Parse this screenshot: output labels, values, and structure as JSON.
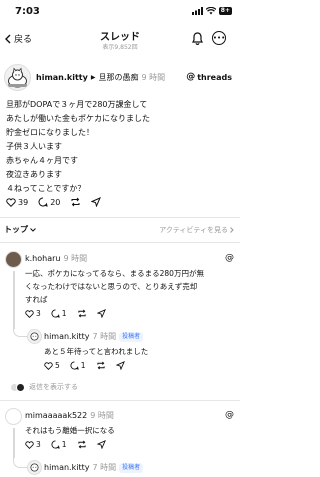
{
  "status_bar": {
    "time": "7:03",
    "battery": "8+"
  },
  "nav": {
    "back_label": "戻る",
    "title": "スレッド",
    "views": "表示9,852回"
  },
  "post": {
    "username": "himan.kitty",
    "arrow": "▶",
    "topic": "旦那の愚痴",
    "time": "9 時間",
    "brand": "threads",
    "lines": [
      "旦那がDOPAで３ヶ月で280万課金して",
      "あたしが働いた金もポケカになりました",
      "貯金ゼロになりました！",
      "子供３人います",
      "赤ちゃん４ヶ月です",
      "夜泣きあります",
      "４ねってことですか？"
    ],
    "likes": "39",
    "comments": "20"
  },
  "sort": {
    "label": "トップ",
    "activity_label": "アクティビティを見る"
  },
  "replies": [
    {
      "username": "k.hoharu",
      "time": "9 時間",
      "lines": [
        "一応、ポケカになってるなら、まるまる280万円が無",
        "くなったわけではないと思うので、とりあえず売却",
        "すれば"
      ],
      "likes": "3",
      "comments": "1",
      "sub": {
        "username": "himan.kitty",
        "time": "7 時間",
        "badge": "投稿者",
        "text": "あと５年待ってと言われました",
        "likes": "5",
        "comments": "1"
      },
      "show_replies": "返信を表示する"
    },
    {
      "username": "mimaaaaak522",
      "time": "9 時間",
      "lines": [
        "それはもう離婚一択になる"
      ],
      "likes": "3",
      "comments": "1",
      "sub": {
        "username": "himan.kitty",
        "time": "7 時間",
        "badge": "投稿者"
      }
    }
  ]
}
